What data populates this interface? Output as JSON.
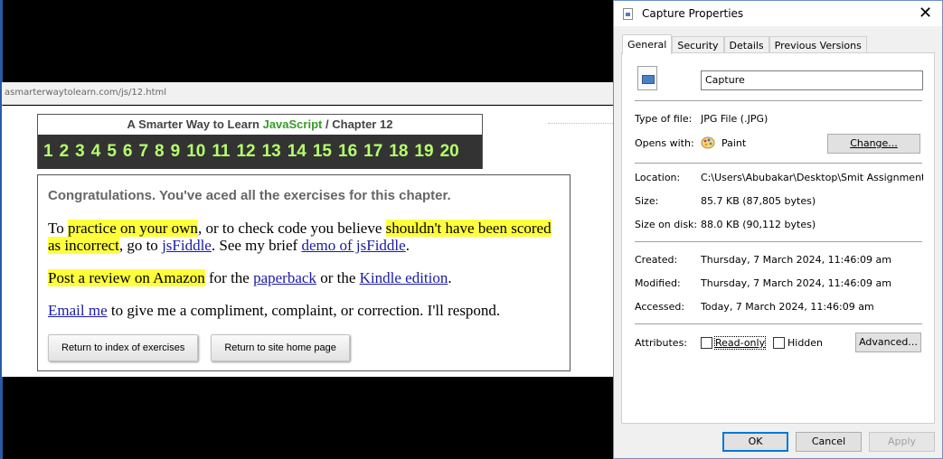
{
  "browser": {
    "url": "asmarterwaytolearn.com/js/12.html"
  },
  "page": {
    "header_prefix": "A Smarter Way to Learn",
    "header_js": "JavaScript",
    "header_sep": "/",
    "header_chapter": "Chapter 12",
    "chapters": [
      "1",
      "2",
      "3",
      "4",
      "5",
      "6",
      "7",
      "8",
      "9",
      "10",
      "11",
      "12",
      "13",
      "14",
      "15",
      "16",
      "17",
      "18",
      "19",
      "20"
    ],
    "congrats": "Congratulations. You've aced all the exercises for this chapter.",
    "p1": {
      "t1": "To ",
      "hl1": "practice on your own",
      "t2": ", or to check code you believe ",
      "hl2": "shouldn't have been scored as incorrect",
      "t3": ", go to ",
      "link1": "jsFiddle",
      "t4": ". See my brief ",
      "link2": "demo of jsFiddle",
      "t5": "."
    },
    "p2": {
      "hl": "Post a review on Amazon",
      "t1": " for the ",
      "link1": "paperback",
      "t2": " or the ",
      "link2": "Kindle edition",
      "t3": "."
    },
    "p3": {
      "link": "Email me",
      "t1": " to give me a compliment, complaint, or correction. I'll respond."
    },
    "buttons": {
      "index": "Return to index of exercises",
      "home": "Return to site home page"
    }
  },
  "dialog": {
    "title": "Capture Properties",
    "close": "✕",
    "tabs": [
      "General",
      "Security",
      "Details",
      "Previous Versions"
    ],
    "file_name": "Capture",
    "type_label": "Type of file:",
    "type_value": "JPG File (.JPG)",
    "opens_label": "Opens with:",
    "opens_value": "Paint",
    "change_button": "Change...",
    "location_label": "Location:",
    "location_value": "C:\\Users\\Abubakar\\Desktop\\Smit Assignments\\Ass",
    "size_label": "Size:",
    "size_value": "85.7 KB (87,805 bytes)",
    "disk_label": "Size on disk:",
    "disk_value": "88.0 KB (90,112 bytes)",
    "created_label": "Created:",
    "created_value": "Thursday, 7 March 2024, 11:46:09 am",
    "modified_label": "Modified:",
    "modified_value": "Thursday, 7 March 2024, 11:46:09 am",
    "accessed_label": "Accessed:",
    "accessed_value": "Today, 7 March 2024, 11:46:09 am",
    "attributes_label": "Attributes:",
    "readonly_label": "Read-only",
    "hidden_label": "Hidden",
    "advanced_button": "Advanced...",
    "ok_button": "OK",
    "cancel_button": "Cancel",
    "apply_button": "Apply"
  }
}
